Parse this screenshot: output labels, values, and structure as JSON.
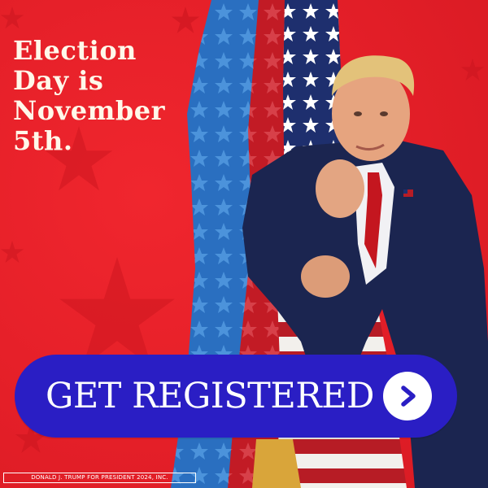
{
  "headline": {
    "lines": [
      "Election",
      "Day is",
      "November",
      "5th."
    ]
  },
  "cta": {
    "label": "GET REGISTERED",
    "arrow_icon": "chevron-right-icon"
  },
  "disclaimer": "DONALD J. TRUMP FOR PRESIDENT 2024, INC.",
  "colors": {
    "background": "#e41f28",
    "button": "#2a1ec4",
    "headline_text": "#fff8ea"
  }
}
